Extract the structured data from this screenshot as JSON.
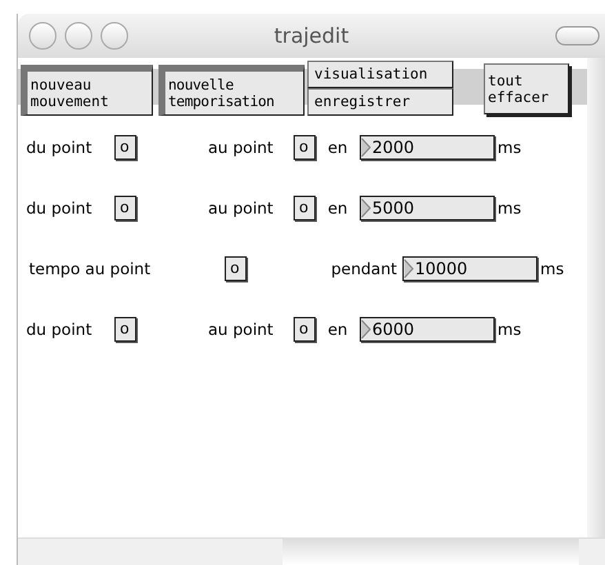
{
  "window": {
    "title": "trajedit"
  },
  "toolbar": [
    {
      "kind": "single",
      "label": "nouveau mouvement"
    },
    {
      "kind": "single",
      "label": "nouvelle temporisation"
    },
    {
      "kind": "stack",
      "labels": [
        "visualisation",
        "enregistrer"
      ]
    },
    {
      "kind": "single",
      "label": "tout effacer"
    }
  ],
  "rows": [
    {
      "kind": "move",
      "from_label": "du point",
      "from": "o",
      "to_label": "au point",
      "to": "o",
      "in_label": "en",
      "duration": "2000",
      "unit": "ms"
    },
    {
      "kind": "move",
      "from_label": "du point",
      "from": "o",
      "to_label": "au point",
      "to": "o",
      "in_label": "en",
      "duration": "5000",
      "unit": "ms"
    },
    {
      "kind": "tempo",
      "point_label": "tempo au point",
      "point": "o",
      "in_label": "pendant",
      "duration": "10000",
      "unit": "ms"
    },
    {
      "kind": "move",
      "from_label": "du point",
      "from": "o",
      "to_label": "au point",
      "to": "o",
      "in_label": "en",
      "duration": "6000",
      "unit": "ms"
    }
  ]
}
